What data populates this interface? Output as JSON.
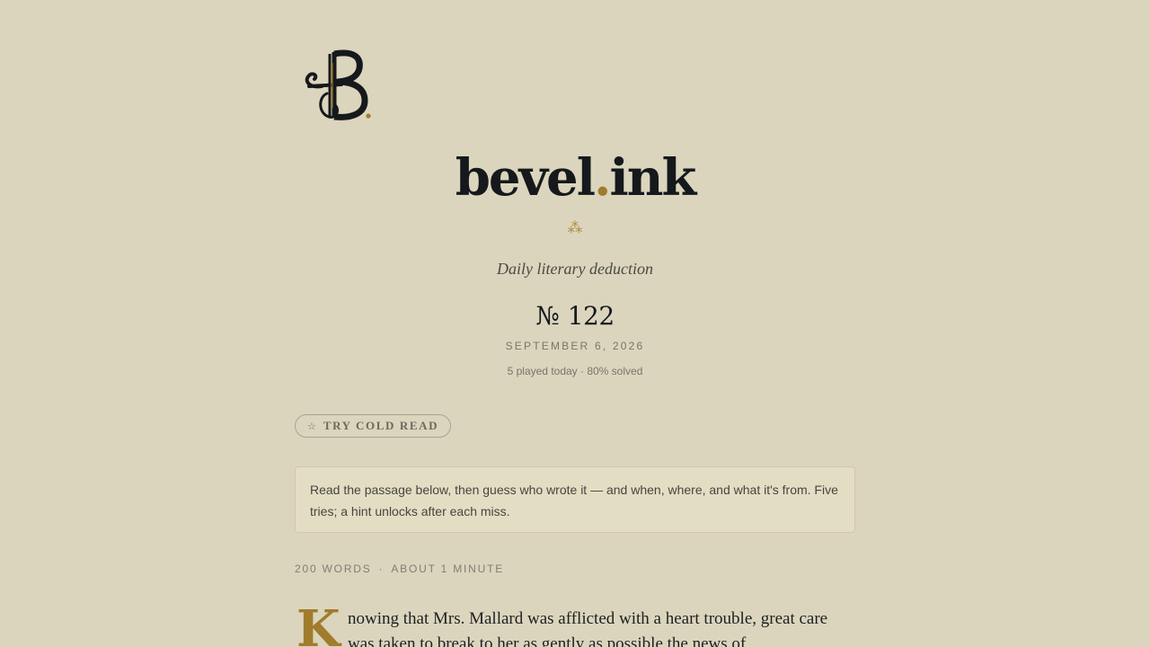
{
  "brand": {
    "name_main": "bevel",
    "name_dot": ".",
    "name_tld": "ink",
    "logo_monogram": "B",
    "accent_color": "#a07c2c",
    "fleuron": "⁂"
  },
  "tagline": "Daily literary deduction",
  "issue": {
    "symbol": "№",
    "number": "122"
  },
  "date": "SEPTEMBER 6, 2026",
  "stats": "5 played today · 80% solved",
  "cold_read": {
    "icon": "star-outline-icon",
    "icon_glyph": "☆",
    "label": "TRY COLD READ"
  },
  "instructions": "Read the passage below, then guess who wrote it — and when, where, and what it's from. Five tries; a hint unlocks after each miss.",
  "meta": {
    "words": "200 WORDS",
    "separator": "·",
    "duration": "ABOUT 1 MINUTE"
  },
  "passage": {
    "drop_cap": "K",
    "text": "nowing that Mrs. Mallard was afflicted with a heart trouble, great care was taken to break to her as gently as possible the news of"
  }
}
